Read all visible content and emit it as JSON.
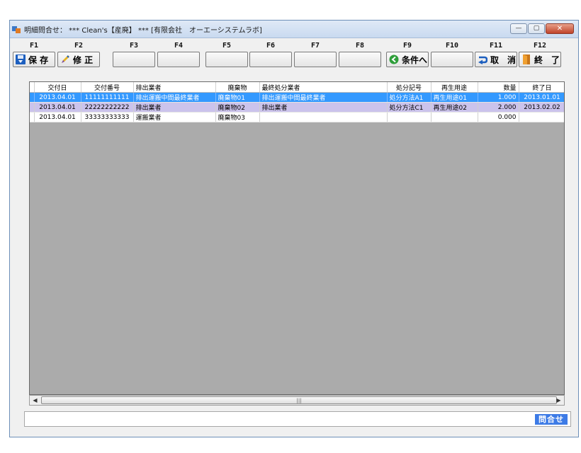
{
  "window": {
    "title": "明細問合せ： *** Clean's【産廃】 *** [有限会社　オーエーシステムラボ]",
    "controls": [
      "minimize",
      "maximize",
      "close"
    ]
  },
  "fkeys": [
    {
      "key": "F1",
      "label": "保 存",
      "icon": "save-icon"
    },
    {
      "key": "F2",
      "label": "修 正",
      "icon": "edit-pencil-icon"
    },
    {
      "key": "F3",
      "label": ""
    },
    {
      "key": "F4",
      "label": ""
    },
    {
      "key": "F5",
      "label": ""
    },
    {
      "key": "F6",
      "label": ""
    },
    {
      "key": "F7",
      "label": ""
    },
    {
      "key": "F8",
      "label": ""
    },
    {
      "key": "F9",
      "label": "条件へ",
      "icon": "back-arrow-icon"
    },
    {
      "key": "F10",
      "label": ""
    },
    {
      "key": "F11",
      "label": "取　消",
      "icon": "undo-icon"
    },
    {
      "key": "F12",
      "label": "終　了",
      "icon": "exit-door-icon"
    }
  ],
  "grid": {
    "columns": [
      "交付日",
      "交付番号",
      "排出業者",
      "廃棄物",
      "最終処分業者",
      "処分記号",
      "再生用途",
      "数量",
      "終了日"
    ],
    "rows": [
      [
        "2013.04.01",
        "11111111111",
        "排出運搬中間最終業者",
        "廃棄物01",
        "排出運搬中間最終業者",
        "処分方法A1",
        "再生用途01",
        "1.000",
        "2013.01.01"
      ],
      [
        "2013.04.01",
        "22222222222",
        "排出業者",
        "廃棄物02",
        "排出業者",
        "処分方法C1",
        "再生用途02",
        "2.000",
        "2013.02.02"
      ],
      [
        "2013.04.01",
        "33333333333",
        "運搬業者",
        "廃棄物03",
        "",
        "",
        "",
        "0.000",
        ""
      ]
    ],
    "selected_row": 0
  },
  "statusbar": {
    "inquiry_label": "問合せ",
    "message": ""
  },
  "colors": {
    "selected_row": "#3399ff",
    "alt_row": "#cbc3ec",
    "grid_background": "#ababab",
    "inquiry_button": "#3d7be6"
  }
}
